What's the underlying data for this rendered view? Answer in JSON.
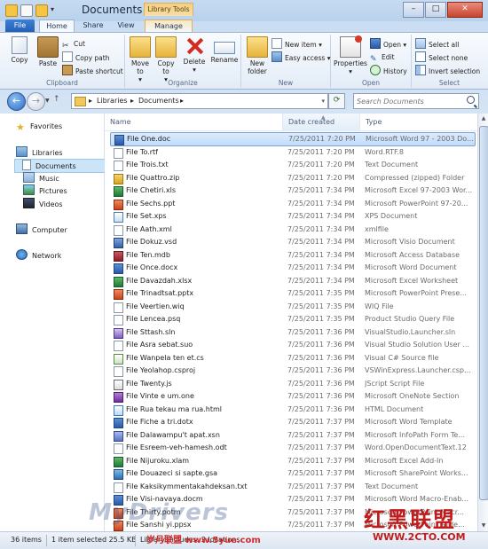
{
  "window": {
    "title": "Documents",
    "contextual_tab_group": "Library Tools",
    "minimize": "–",
    "maximize": "□",
    "close": "✕"
  },
  "ribbon": {
    "tabs": [
      "File",
      "Home",
      "Share",
      "View",
      "Manage"
    ],
    "groups": {
      "clipboard": {
        "label": "Clipboard",
        "copy": "Copy",
        "paste": "Paste",
        "cut": "Cut",
        "copy_path": "Copy path",
        "paste_shortcut": "Paste shortcut"
      },
      "organize": {
        "label": "Organize",
        "move_to": "Move to",
        "copy_to": "Copy to",
        "delete": "Delete",
        "rename": "Rename"
      },
      "new": {
        "label": "New",
        "new_folder": "New folder",
        "new_item": "New item",
        "easy_access": "Easy access"
      },
      "open": {
        "label": "Open",
        "properties": "Properties",
        "open": "Open",
        "edit": "Edit",
        "history": "History"
      },
      "select": {
        "label": "Select",
        "select_all": "Select all",
        "select_none": "Select none",
        "invert_selection": "Invert selection"
      }
    }
  },
  "address": {
    "breadcrumbs": [
      "Libraries",
      "Documents"
    ],
    "separator": "▸",
    "search_placeholder": "Search Documents"
  },
  "navpane": {
    "favorites": "Favorites",
    "libraries": "Libraries",
    "documents": "Documents",
    "music": "Music",
    "pictures": "Pictures",
    "videos": "Videos",
    "computer": "Computer",
    "network": "Network"
  },
  "columns": {
    "name": "Name",
    "date": "Date created",
    "type": "Type"
  },
  "files": [
    {
      "name": "File One.doc",
      "date": "7/25/2011 7:20 PM",
      "type": "Microsoft Word 97 - 2003 Do...",
      "icon": "word"
    },
    {
      "name": "File To.rtf",
      "date": "7/25/2011 7:20 PM",
      "type": "Word.RTF.8",
      "icon": "plain"
    },
    {
      "name": "File Trois.txt",
      "date": "7/25/2011 7:20 PM",
      "type": "Text Document",
      "icon": "plain"
    },
    {
      "name": "File Quattro.zip",
      "date": "7/25/2011 7:20 PM",
      "type": "Compressed (zipped) Folder",
      "icon": "zip"
    },
    {
      "name": "File Chetiri.xls",
      "date": "7/25/2011 7:34 PM",
      "type": "Microsoft Excel 97-2003 Wor...",
      "icon": "excel"
    },
    {
      "name": "File Sechs.ppt",
      "date": "7/25/2011 7:34 PM",
      "type": "Microsoft PowerPoint 97-20...",
      "icon": "ppt"
    },
    {
      "name": "File Set.xps",
      "date": "7/25/2011 7:34 PM",
      "type": "XPS Document",
      "icon": "xps"
    },
    {
      "name": "File Aath.xml",
      "date": "7/25/2011 7:34 PM",
      "type": "xmlfile",
      "icon": "plain"
    },
    {
      "name": "File Dokuz.vsd",
      "date": "7/25/2011 7:34 PM",
      "type": "Microsoft Visio Document",
      "icon": "visio"
    },
    {
      "name": "File Ten.mdb",
      "date": "7/25/2011 7:34 PM",
      "type": "Microsoft Access Database",
      "icon": "access"
    },
    {
      "name": "File Once.docx",
      "date": "7/25/2011 7:34 PM",
      "type": "Microsoft Word Document",
      "icon": "word"
    },
    {
      "name": "File Davazdah.xlsx",
      "date": "7/25/2011 7:34 PM",
      "type": "Microsoft Excel Worksheet",
      "icon": "excel"
    },
    {
      "name": "File Trinadtsat.pptx",
      "date": "7/25/2011 7:35 PM",
      "type": "Microsoft PowerPoint Prese...",
      "icon": "ppt"
    },
    {
      "name": "File Veertien.wiq",
      "date": "7/25/2011 7:35 PM",
      "type": "WIQ File",
      "icon": "plain"
    },
    {
      "name": "File Lencea.psq",
      "date": "7/25/2011 7:35 PM",
      "type": "Product Studio Query File",
      "icon": "plain"
    },
    {
      "name": "File Sttash.sln",
      "date": "7/25/2011 7:36 PM",
      "type": "VisualStudio.Launcher.sln",
      "icon": "sln"
    },
    {
      "name": "File Asra sebat.suo",
      "date": "7/25/2011 7:36 PM",
      "type": "Visual Studio Solution User ...",
      "icon": "plain"
    },
    {
      "name": "File Wanpela ten et.cs",
      "date": "7/25/2011 7:36 PM",
      "type": "Visual C# Source file",
      "icon": "cs"
    },
    {
      "name": "File Yeolahop.csproj",
      "date": "7/25/2011 7:36 PM",
      "type": "VSWinExpress.Launcher.cspr...",
      "icon": "plain"
    },
    {
      "name": "File Twenty.js",
      "date": "7/25/2011 7:36 PM",
      "type": "JScript Script File",
      "icon": "js"
    },
    {
      "name": "File Vinte e um.one",
      "date": "7/25/2011 7:36 PM",
      "type": "Microsoft OneNote Section",
      "icon": "note"
    },
    {
      "name": "File Rua tekau ma rua.html",
      "date": "7/25/2011 7:36 PM",
      "type": "HTML Document",
      "icon": "web"
    },
    {
      "name": "File Fiche a tri.dotx",
      "date": "7/25/2011 7:37 PM",
      "type": "Microsoft Word Template",
      "icon": "word"
    },
    {
      "name": "File Dalawampu't apat.xsn",
      "date": "7/25/2011 7:37 PM",
      "type": "Microsoft InfoPath Form Te...",
      "icon": "info"
    },
    {
      "name": "File Esreem-veh-hamesh.odt",
      "date": "7/25/2011 7:37 PM",
      "type": "Word.OpenDocumentText.12",
      "icon": "plain"
    },
    {
      "name": "File Nijuroku.xlam",
      "date": "7/25/2011 7:37 PM",
      "type": "Microsoft Excel Add-In",
      "icon": "excel"
    },
    {
      "name": "File Douazeci si sapte.gsa",
      "date": "7/25/2011 7:37 PM",
      "type": "Microsoft SharePoint Works...",
      "icon": "sp"
    },
    {
      "name": "File Kaksikymmentakahdeksan.txt",
      "date": "7/25/2011 7:37 PM",
      "type": "Text Document",
      "icon": "plain"
    },
    {
      "name": "File Visi-navaya.docm",
      "date": "7/25/2011 7:37 PM",
      "type": "Microsoft Word Macro-Enab...",
      "icon": "word"
    },
    {
      "name": "File Thirty.potm",
      "date": "7/25/2011 7:37 PM",
      "type": "Microsoft PowerPoint Macr...",
      "icon": "ppt"
    },
    {
      "name": "File Sanshi yi.ppsx",
      "date": "7/25/2011 7:37 PM",
      "type": "Microsoft PowerPoint Slide...",
      "icon": "ppt"
    }
  ],
  "selected_index": 0,
  "status": {
    "item_count": "36 items",
    "selection": "1 item selected  25.5 KB",
    "library": "Library includes: 2 locations"
  },
  "watermarks": {
    "overlay": "MyDrivers",
    "brand_cn": "红黑联盟",
    "url": "WWW.2CTO.COM",
    "site_cn": "岁月联盟 www.5yue.com"
  }
}
